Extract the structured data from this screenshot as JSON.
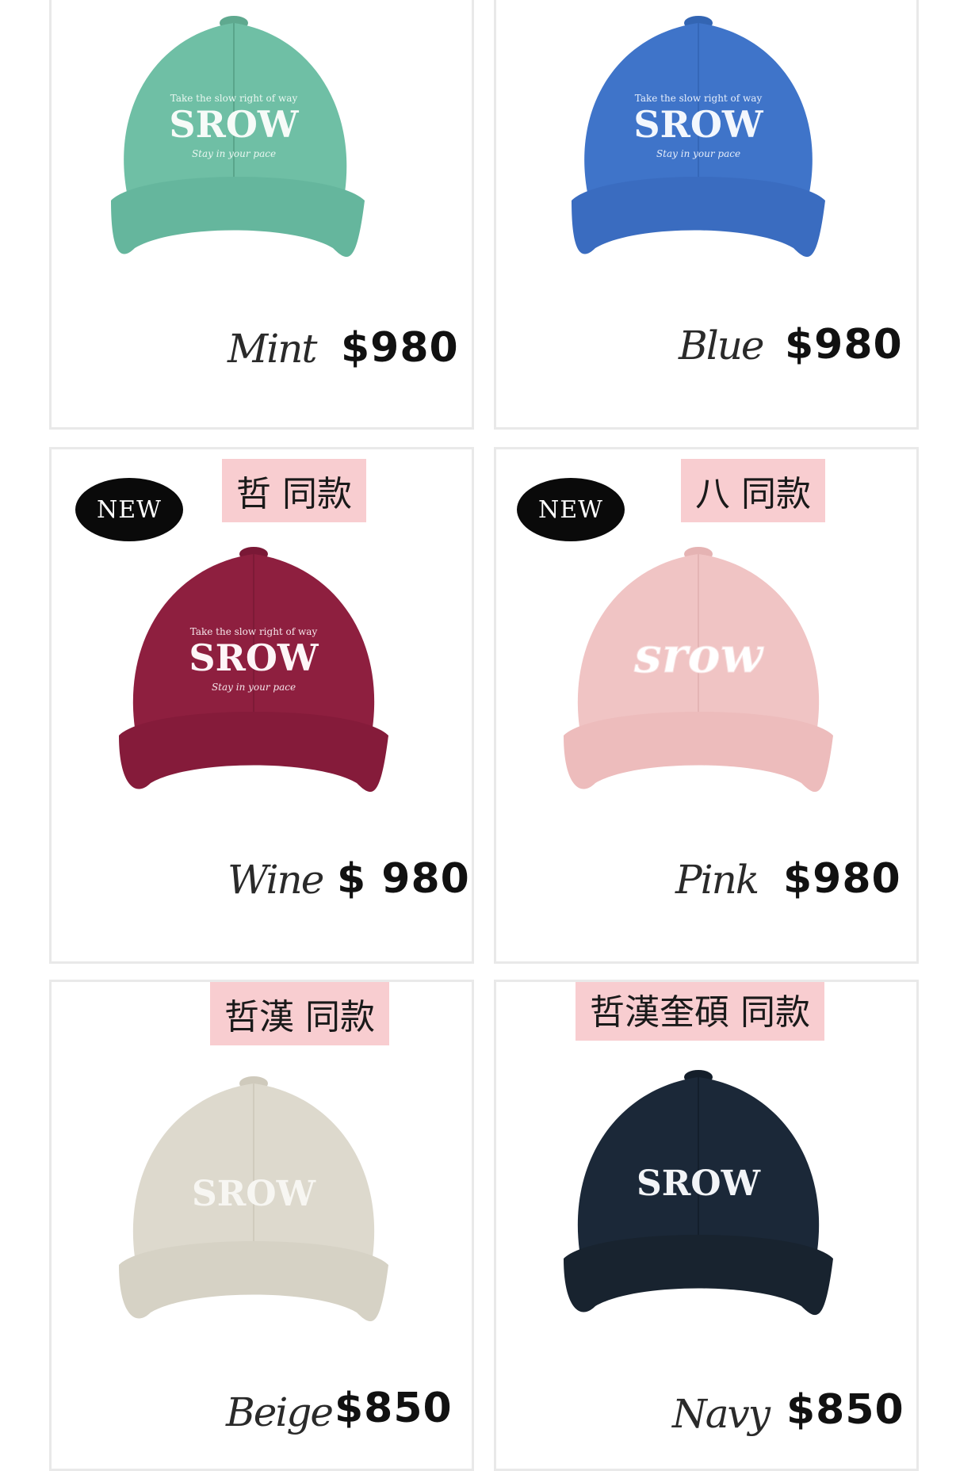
{
  "products": [
    {
      "color": "Mint",
      "price": "$980",
      "cap_color": "#6fbfa5",
      "brim_color": "#65b69d",
      "logo": "SROW",
      "tagline_top": "Take the slow right of way",
      "tagline_bottom": "Stay in your pace"
    },
    {
      "color": "Blue",
      "price": "$980",
      "cap_color": "#3f74c9",
      "brim_color": "#3a6cc0",
      "logo": "SROW",
      "tagline_top": "Take the slow right of way",
      "tagline_bottom": "Stay in your pace"
    },
    {
      "color": "Wine",
      "price": "$ 980",
      "badge": "NEW",
      "tag": "哲 同款",
      "cap_color": "#8e1f3f",
      "brim_color": "#851b3a",
      "logo": "SROW",
      "tagline_top": "Take the slow right of way",
      "tagline_bottom": "Stay in your pace"
    },
    {
      "color": "Pink",
      "price": "$980",
      "badge": "NEW",
      "tag": "八 同款",
      "cap_color": "#f0c4c4",
      "brim_color": "#edbcbc",
      "logo": "srow"
    },
    {
      "color": "Beige",
      "price": "$850",
      "tag": "哲漢 同款",
      "cap_color": "#ddd9cd",
      "brim_color": "#d6d2c5",
      "logo": "SROW"
    },
    {
      "color": "Navy",
      "price": "$850",
      "tag": "哲漢奎碩 同款",
      "cap_color": "#1b2838",
      "brim_color": "#18232f",
      "logo": "SROW"
    }
  ]
}
